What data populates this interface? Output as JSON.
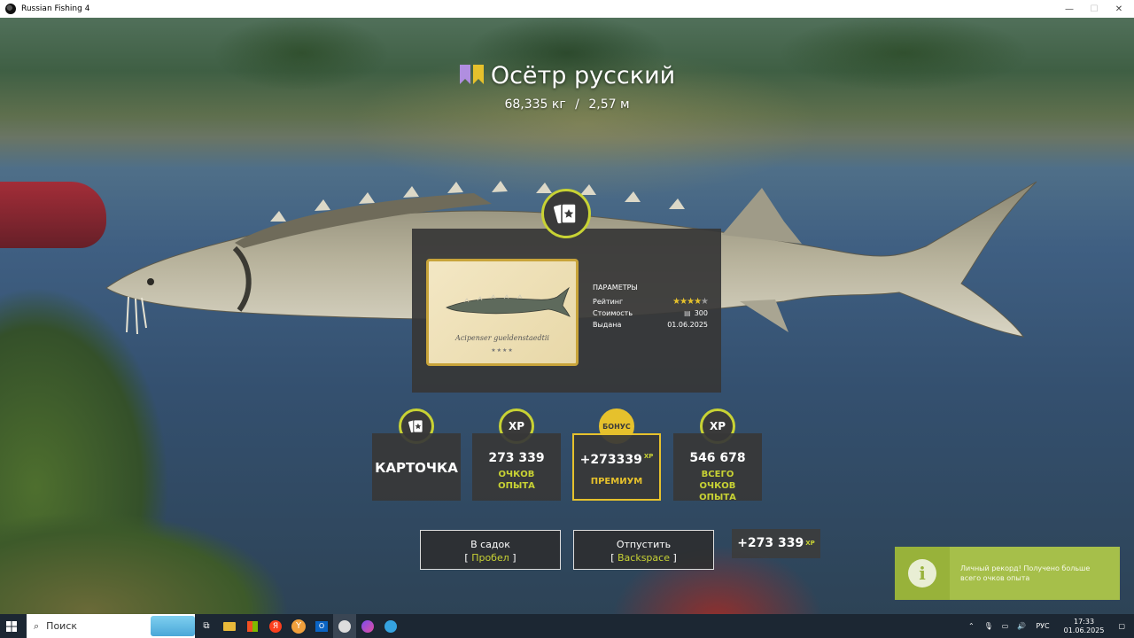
{
  "window": {
    "title": "Russian Fishing 4",
    "controls": [
      "minimize",
      "maximize",
      "close"
    ]
  },
  "catch": {
    "name": "Осётр русский",
    "weight": "68,335 кг",
    "separator": "/",
    "length": "2,57 м"
  },
  "card": {
    "latin_name": "Acipenser gueldenstaedtii",
    "stars_caption": "★★★★",
    "params_title": "ПАРАМЕТРЫ",
    "rating_label": "Рейтинг",
    "rating_value": 4,
    "rating_max": 5,
    "cost_label": "Стоимость",
    "cost_value": "300",
    "issued_label": "Выдана",
    "issued_value": "01.06.2025"
  },
  "rewards": {
    "card_label": "КАРТОЧКА",
    "xp_icon": "XP",
    "bonus_icon": "БОНУС",
    "experience_points": "273 339",
    "experience_label": "ОЧКОВ ОПЫТА",
    "premium_points": "+273339",
    "premium_sup": "XP",
    "premium_label": "ПРЕМИУМ",
    "total_points": "546 678",
    "total_label": "ВСЕГО ОЧКОВ ОПЫТА"
  },
  "actions": {
    "keep_label": "В садок",
    "keep_key_open": "[",
    "keep_key": "Пробел",
    "keep_key_close": "]",
    "release_label": "Отпустить",
    "release_key_open": "[",
    "release_key": "Backspace",
    "release_key_close": "]",
    "xp_gain": "+273 339",
    "xp_gain_sup": "XP"
  },
  "toast": {
    "message": "Личный рекорд! Получено больше всего очков опыта",
    "icon": "info-icon"
  },
  "taskbar": {
    "search_placeholder": "Поиск",
    "language": "РУС",
    "time": "17:33",
    "date": "01.06.2025"
  },
  "colors": {
    "accent_green": "#c8d234",
    "accent_gold": "#e6c12c",
    "toast_bg": "#98b23a"
  }
}
